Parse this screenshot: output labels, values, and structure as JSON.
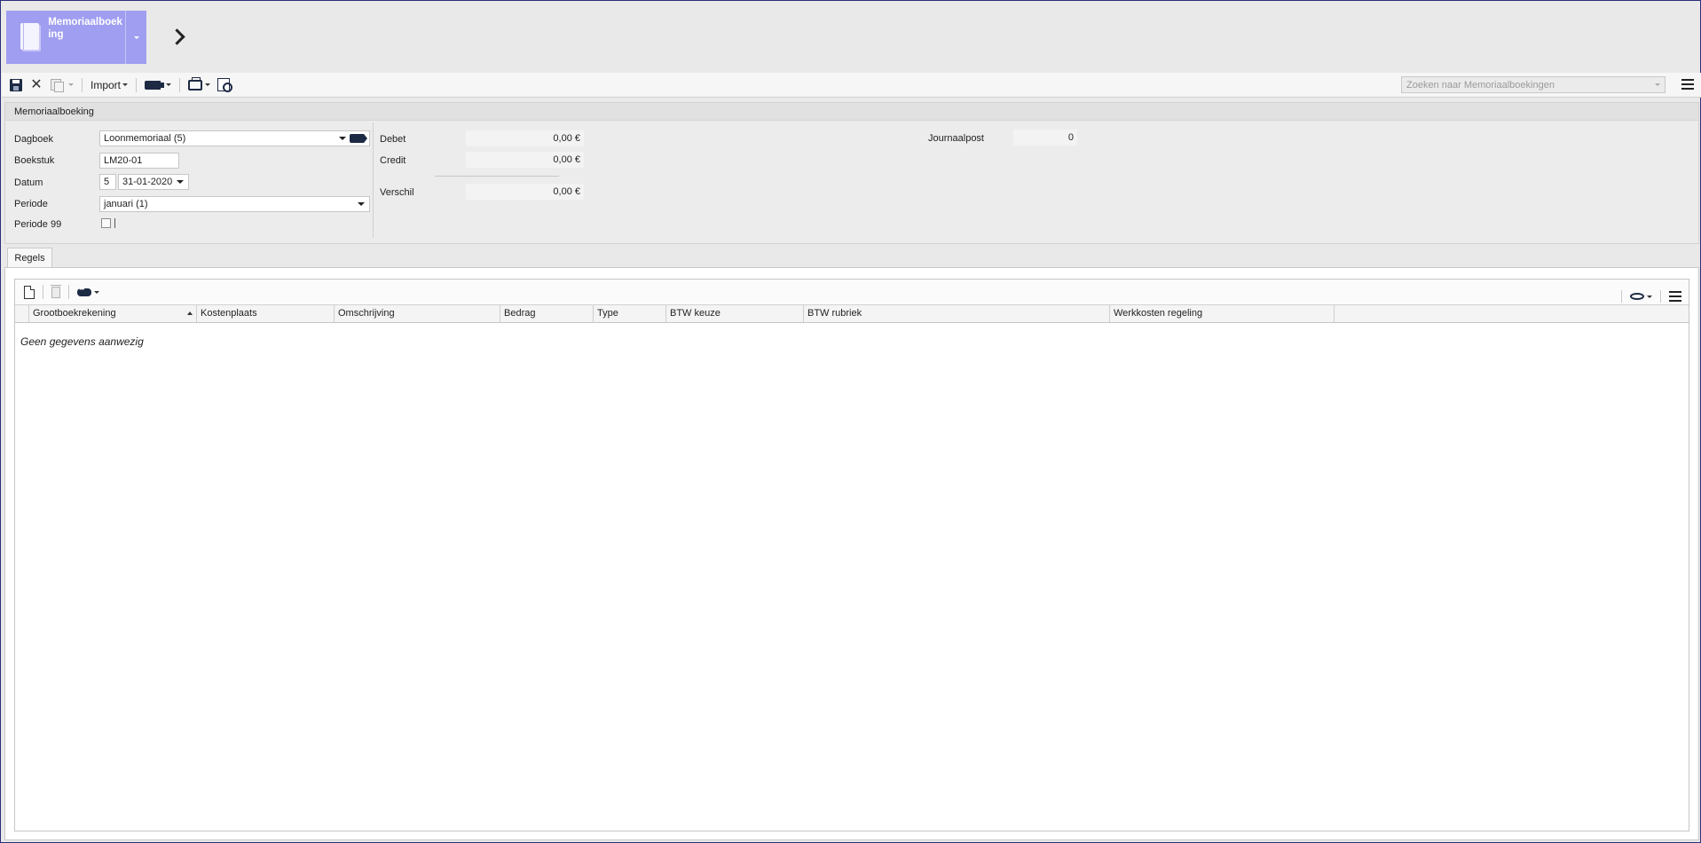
{
  "header": {
    "tile_title": "Memoriaalboeking",
    "accent_color": "#a09ef0"
  },
  "toolbar": {
    "import_label": "Import",
    "search_placeholder": "Zoeken naar Memoriaalboekingen"
  },
  "panel": {
    "title": "Memoriaalboeking",
    "labels": {
      "dagboek": "Dagboek",
      "boekstuk": "Boekstuk",
      "datum": "Datum",
      "periode": "Periode",
      "periode99": "Periode 99",
      "debet": "Debet",
      "credit": "Credit",
      "verschil": "Verschil",
      "journaalpost": "Journaalpost"
    },
    "values": {
      "dagboek": "Loonmemoriaal (5)",
      "boekstuk": "LM20-01",
      "datum_day": "5",
      "datum_date": "31-01-2020",
      "periode": "januari (1)",
      "debet": "0,00 €",
      "credit": "0,00 €",
      "verschil": "0,00 €",
      "journaalpost": "0"
    }
  },
  "tabs": [
    {
      "label": "Regels",
      "active": true
    }
  ],
  "grid": {
    "columns": [
      "Grootboekrekening",
      "Kostenplaats",
      "Omschrijving",
      "Bedrag",
      "Type",
      "BTW keuze",
      "BTW rubriek",
      "Werkkosten regeling"
    ],
    "empty_message": "Geen gegevens aanwezig"
  }
}
